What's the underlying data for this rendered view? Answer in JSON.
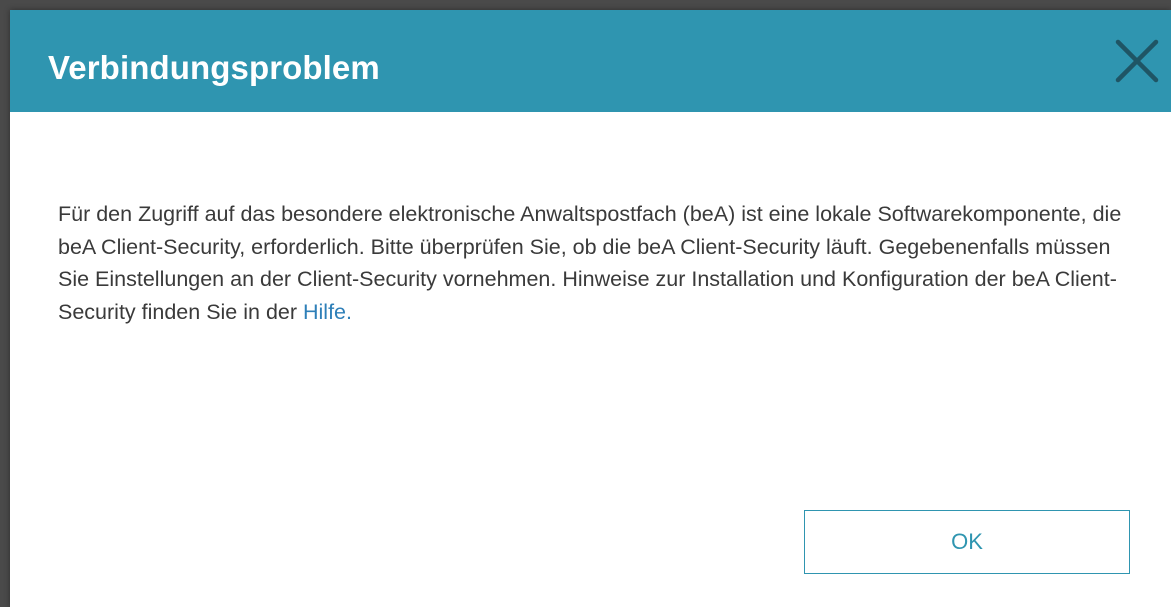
{
  "dialog": {
    "title": "Verbindungsproblem",
    "close_icon": "close-icon",
    "body_text": "Für den Zugriff auf das besondere elektronische Anwaltspostfach (beA) ist eine lokale Softwarekomponente, die beA Client-Security, erforderlich. Bitte überprüfen Sie, ob die beA Client-Security läuft. Gegebenenfalls müssen Sie Einstellungen an der Client-Security vornehmen. Hinweise zur Installation und Konfiguration der beA Client-Security finden Sie in der ",
    "help_link_label": "Hilfe",
    "body_end": ".",
    "ok_label": "OK"
  },
  "colors": {
    "header_background": "#2f95b0",
    "title_text": "#ffffff",
    "body_text": "#3a3a3a",
    "link": "#2e7fb8",
    "button_border": "#2f95b0"
  }
}
